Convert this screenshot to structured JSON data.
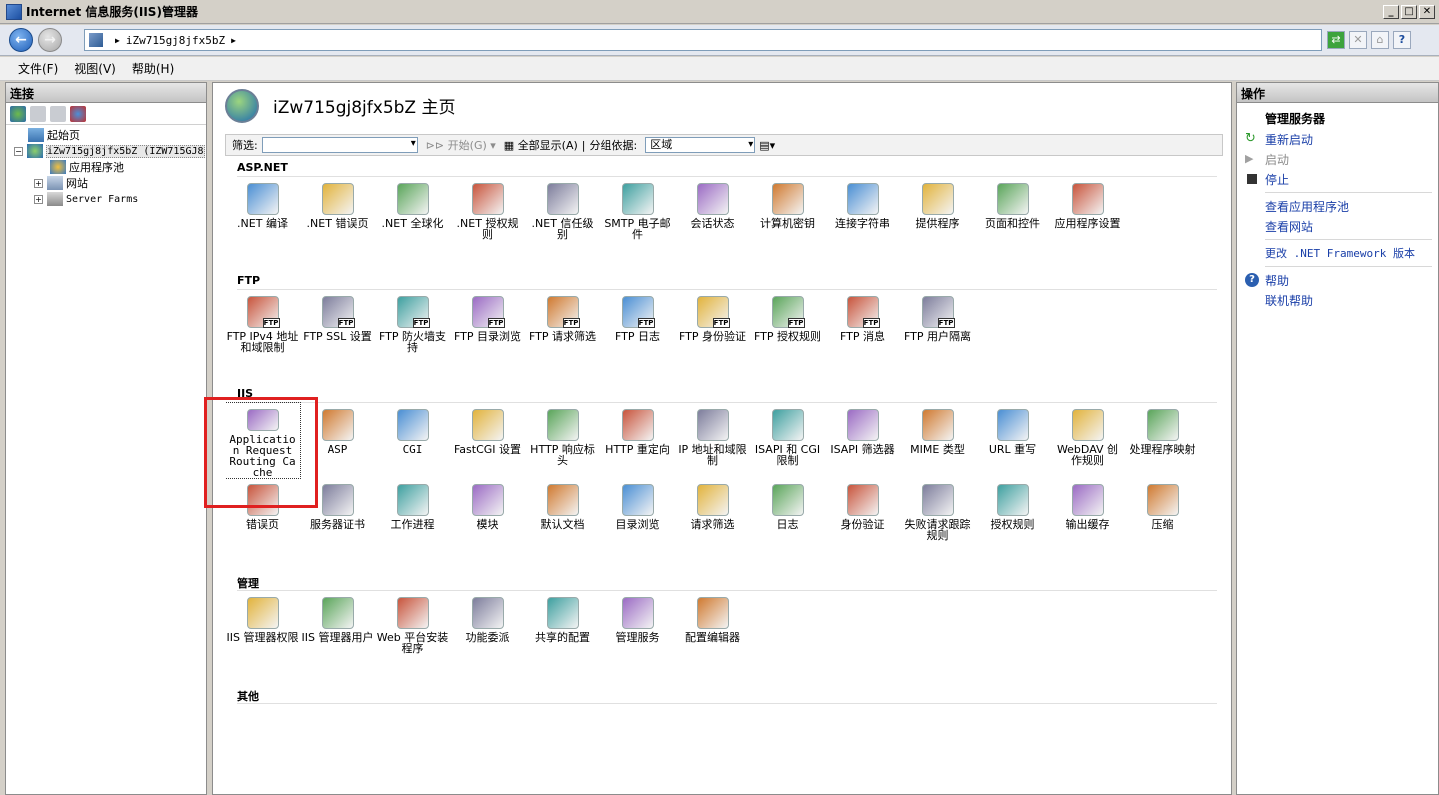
{
  "window": {
    "title": "Internet 信息服务(IIS)管理器",
    "buttons": [
      "_",
      "□",
      "✕"
    ]
  },
  "address": {
    "path": [
      "iZw715gj8jfx5bZ"
    ]
  },
  "menu": [
    {
      "label": "文件(F)"
    },
    {
      "label": "视图(V)"
    },
    {
      "label": "帮助(H)"
    }
  ],
  "left": {
    "header": "连接",
    "tree": {
      "start": "起始页",
      "server": "iZw715gj8jfx5bZ (IZW715GJ8",
      "apppools": "应用程序池",
      "sites": "网站",
      "farms": "Server Farms"
    }
  },
  "center": {
    "title": "iZw715gj8jfx5bZ 主页",
    "filter": {
      "label": "筛选:",
      "go": "开始(G)",
      "showall": "全部显示(A)",
      "groupby": "分组依据:",
      "group_value": "区域"
    },
    "groups": [
      {
        "title": "ASP.NET",
        "items": [
          ".NET 编译",
          ".NET 错误页",
          ".NET 全球化",
          ".NET 授权规则",
          ".NET 信任级别",
          "SMTP 电子邮件",
          "会话状态",
          "计算机密钥",
          "连接字符串",
          "提供程序",
          "页面和控件",
          "应用程序设置"
        ]
      },
      {
        "title": "FTP",
        "items": [
          "FTP IPv4 地址和域限制",
          "FTP SSL 设置",
          "FTP 防火墙支持",
          "FTP 目录浏览",
          "FTP 请求筛选",
          "FTP 日志",
          "FTP 身份验证",
          "FTP 授权规则",
          "FTP 消息",
          "FTP 用户隔离"
        ]
      },
      {
        "title": "IIS",
        "items": [
          "Application Request Routing Cache",
          "ASP",
          "CGI",
          "FastCGI 设置",
          "HTTP 响应标头",
          "HTTP 重定向",
          "IP 地址和域限制",
          "ISAPI 和 CGI 限制",
          "ISAPI 筛选器",
          "MIME 类型",
          "URL 重写",
          "WebDAV 创作规则",
          "处理程序映射",
          "错误页",
          "服务器证书",
          "工作进程",
          "模块",
          "默认文档",
          "目录浏览",
          "请求筛选",
          "日志",
          "身份验证",
          "失败请求跟踪规则",
          "授权规则",
          "输出缓存",
          "压缩"
        ]
      },
      {
        "title": "管理",
        "items": [
          "IIS 管理器权限",
          "IIS 管理器用户",
          "Web 平台安装程序",
          "功能委派",
          "共享的配置",
          "管理服务",
          "配置编辑器"
        ]
      },
      {
        "title": "其他",
        "items": []
      }
    ]
  },
  "right": {
    "header": "操作",
    "section_title": "管理服务器",
    "restart": "重新启动",
    "start": "启动",
    "stop": "停止",
    "view_apppools": "查看应用程序池",
    "view_sites": "查看网站",
    "change_net": "更改 .NET Framework 版本",
    "help": "帮助",
    "online_help": "联机帮助"
  },
  "colors": {
    "accent": "#1a3fa8",
    "highlight": "#e02020"
  }
}
